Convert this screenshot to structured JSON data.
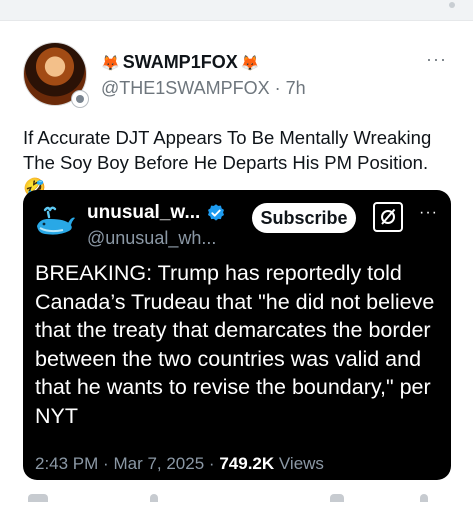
{
  "post": {
    "display_name": "SWAMP1FOX",
    "name_emoji_left": "🦊",
    "name_emoji_right": "🦊",
    "handle": "@THE1SWAMPFOX",
    "separator": "·",
    "time": "7h",
    "more": "···",
    "text": "If Accurate DJT Appears To Be Mentally Wreaking The Soy Boy Before He Departs His PM Position. 🤣",
    "avatar_icon": "fox-avatar-icon",
    "badge_icon": "affiliate-badge-icon"
  },
  "embed": {
    "display_name": "unusual_w...",
    "handle": "@unusual_wh...",
    "subscribe_label": "Subscribe",
    "more": "···",
    "text": "BREAKING: Trump has reportedly told Canada’s Trudeau that \"he did not believe that the treaty that demarcates the border between the two countries was valid and that he wants to revise the boundary,\" per NYT",
    "time": "2:43 PM",
    "sep1": "·",
    "date": "Mar 7, 2025",
    "sep2": "·",
    "views_count": "749.2K",
    "views_label": "Views",
    "avatar_icon": "whale-icon",
    "verified_icon": "verified-badge-icon",
    "grok_icon": "grok-icon",
    "verified_color": "#1d9bf0"
  }
}
